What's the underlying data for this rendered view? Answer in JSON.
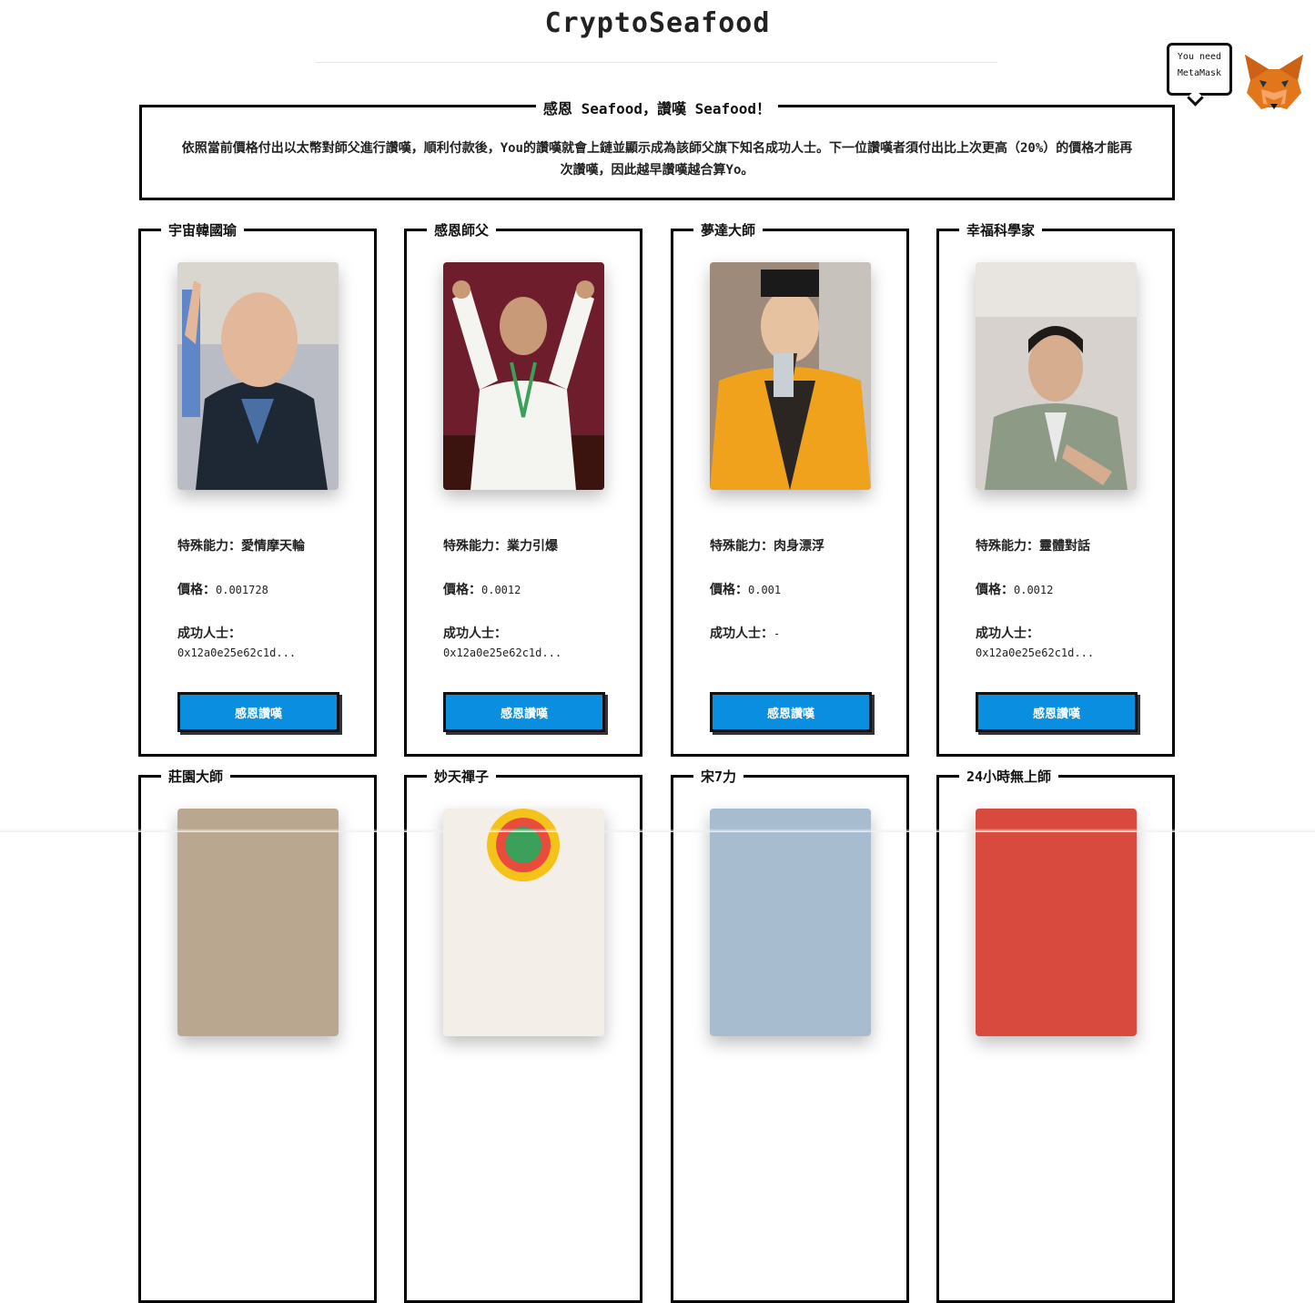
{
  "header": {
    "title": "CryptoSeafood"
  },
  "metamask": {
    "bubble_line1": "You need",
    "bubble_line2": "MetaMask",
    "icon": "metamask-fox-icon"
  },
  "intro": {
    "legend": "感恩 Seafood，讚嘆 Seafood！",
    "text": "依照當前價格付出以太幣對師父進行讚嘆，順利付款後，You的讚嘆就會上鏈並顯示成為該師父旗下知名成功人士。下一位讚嘆者須付出比上次更高（20%）的價格才能再次讚嘆，因此越早讚嘆越合算Yo。"
  },
  "labels": {
    "ability": "特殊能力：",
    "price": "價格：",
    "winner": "成功人士：",
    "button": "感恩讚嘆"
  },
  "accent_color": "#0a8fe0",
  "cards": [
    {
      "name": "宇宙韓國瑜",
      "ability": "愛情摩天輪",
      "price": "0.001728",
      "winner": "",
      "address": "0x12a0e25e62c1d..."
    },
    {
      "name": "感恩師父",
      "ability": "業力引爆",
      "price": "0.0012",
      "winner": "",
      "address": "0x12a0e25e62c1d..."
    },
    {
      "name": "夢達大師",
      "ability": "肉身漂浮",
      "price": "0.001",
      "winner": "-",
      "address": ""
    },
    {
      "name": "幸福科學家",
      "ability": "靈體對話",
      "price": "0.0012",
      "winner": "",
      "address": "0x12a0e25e62c1d..."
    },
    {
      "name": "莊園大師",
      "ability": "",
      "price": "",
      "winner": "",
      "address": ""
    },
    {
      "name": "妙天禪子",
      "ability": "",
      "price": "",
      "winner": "",
      "address": ""
    },
    {
      "name": "宋7力",
      "ability": "",
      "price": "",
      "winner": "",
      "address": ""
    },
    {
      "name": "24小時無上師",
      "ability": "",
      "price": "",
      "winner": "",
      "address": ""
    }
  ]
}
